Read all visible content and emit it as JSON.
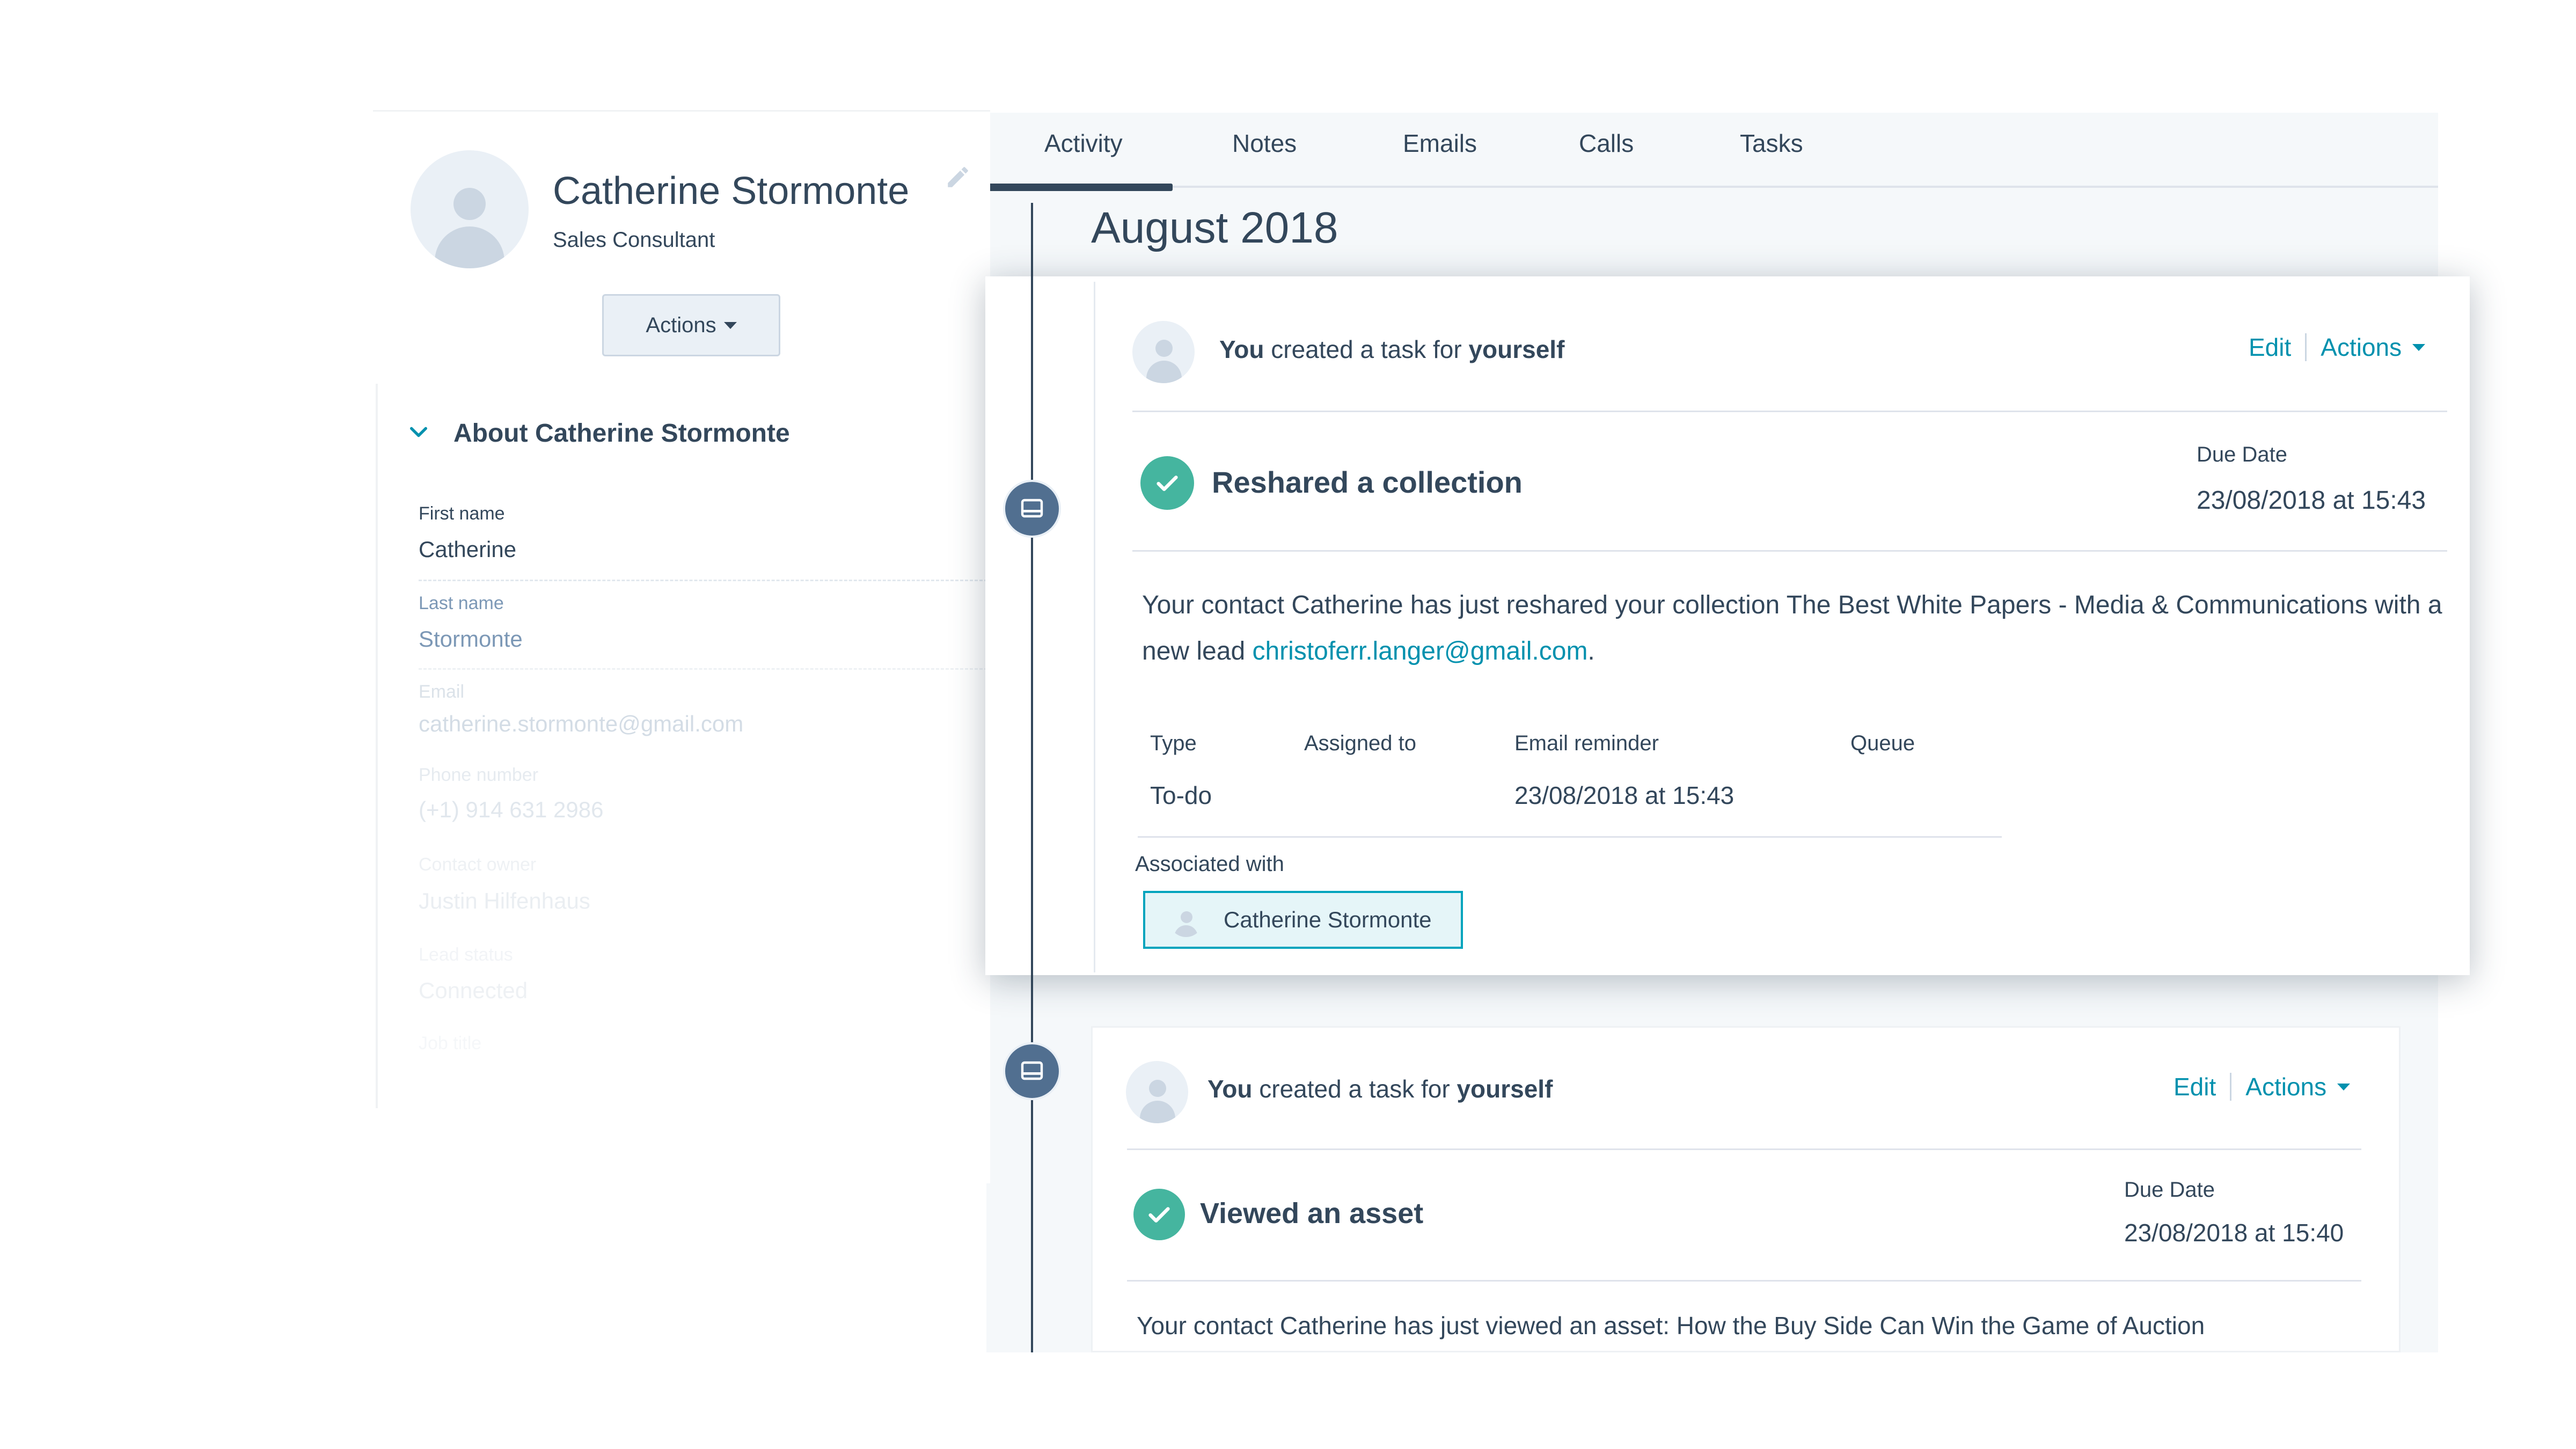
{
  "contact": {
    "name": "Catherine Stormonte",
    "title": "Sales Consultant",
    "actions_label": "Actions"
  },
  "about": {
    "title": "About Catherine Stormonte",
    "properties": [
      {
        "label": "First name",
        "value": "Catherine"
      },
      {
        "label": "Last name",
        "value": "Stormonte"
      },
      {
        "label": "Email",
        "value": "catherine.stormonte@gmail.com"
      },
      {
        "label": "Phone number",
        "value": "(+1) 914 631 2986"
      },
      {
        "label": "Contact owner",
        "value": "Justin Hilfenhaus"
      },
      {
        "label": "Lead status",
        "value": "Connected"
      },
      {
        "label": "Job title",
        "value": ""
      }
    ]
  },
  "tabs": [
    {
      "label": "Activity",
      "active": true
    },
    {
      "label": "Notes"
    },
    {
      "label": "Emails"
    },
    {
      "label": "Calls"
    },
    {
      "label": "Tasks"
    }
  ],
  "timeline": {
    "month": "August 2018",
    "cards": [
      {
        "header_you": "You",
        "header_mid": "created a task for",
        "header_target": "yourself",
        "edit_label": "Edit",
        "actions_label": "Actions",
        "title": "Reshared a collection",
        "due_label": "Due Date",
        "due_value": "23/08/2018 at 15:43",
        "body_prefix": "Your contact Catherine has just reshared your collection The Best White Papers - Media & Communications with a new lead ",
        "body_link": "christoferr.langer@gmail.com",
        "body_suffix": ".",
        "meta": {
          "type_label": "Type",
          "type_value": "To-do",
          "assigned_label": "Assigned to",
          "assigned_value": "",
          "reminder_label": "Email reminder",
          "reminder_value": "23/08/2018 at 15:43",
          "queue_label": "Queue",
          "queue_value": ""
        },
        "associated_label": "Associated with",
        "associated_contact": "Catherine Stormonte"
      },
      {
        "header_you": "You",
        "header_mid": "created a task for",
        "header_target": "yourself",
        "edit_label": "Edit",
        "actions_label": "Actions",
        "title": "Viewed an asset",
        "due_label": "Due Date",
        "due_value": "23/08/2018 at 15:40",
        "body_text": "Your contact Catherine has just viewed an asset: How the Buy Side Can Win the Game of Auction"
      }
    ]
  },
  "colors": {
    "text": "#33475b",
    "link": "#0091ae",
    "success": "#45b59f",
    "timeline_dot": "#516f90",
    "panel_bg": "#f5f8fa"
  }
}
